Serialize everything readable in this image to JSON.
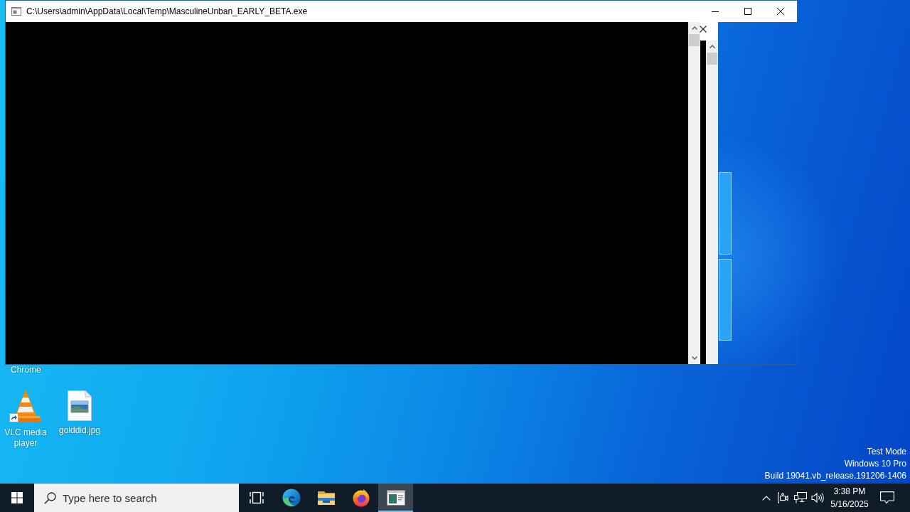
{
  "window": {
    "title": "C:\\Users\\admin\\AppData\\Local\\Temp\\MasculineUnban_EARLY_BETA.exe"
  },
  "desktop": {
    "label_below_window": "Chrome",
    "icons": [
      {
        "kind": "vlc-shortcut",
        "label": "VLC media player"
      },
      {
        "kind": "image-file",
        "label": "golddid.jpg"
      }
    ],
    "system_notice": [
      "Test Mode",
      "Windows 10 Pro",
      "Build 19041.vb_release.191206-1406"
    ]
  },
  "taskbar": {
    "search": {
      "placeholder": "Type here to search"
    },
    "apps": [
      {
        "kind": "task-view",
        "active": false
      },
      {
        "kind": "edge",
        "active": false
      },
      {
        "kind": "file-explorer",
        "active": false
      },
      {
        "kind": "firefox",
        "active": false
      },
      {
        "kind": "console",
        "active": true
      }
    ],
    "clock": {
      "time": "3:38 PM",
      "date": "5/16/2025"
    }
  }
}
